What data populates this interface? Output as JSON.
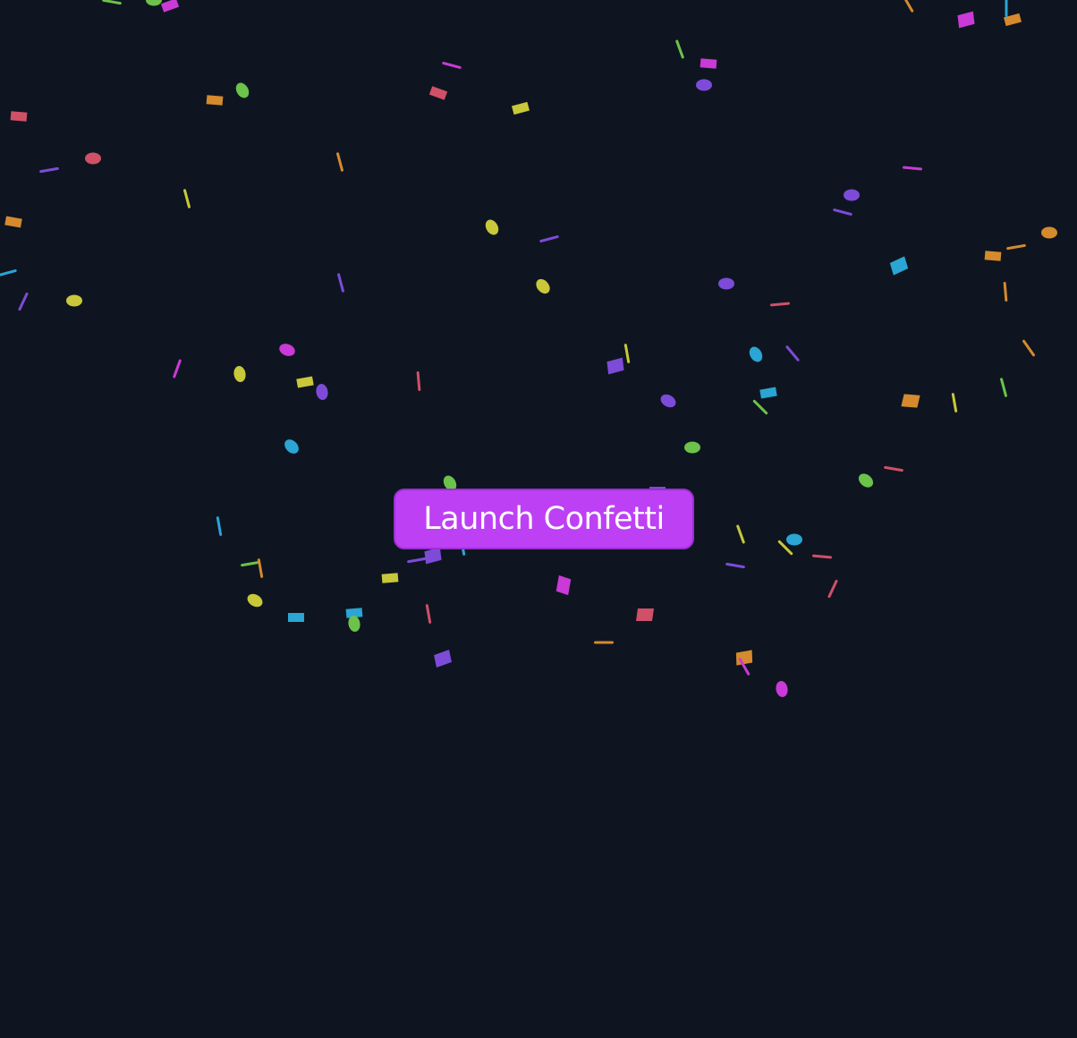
{
  "launch_button": {
    "label": "Launch Confetti"
  },
  "theme": {
    "background": "#0e1520",
    "button_color": "#bd40f5"
  },
  "confetti": {
    "palette": [
      "#c93ad6",
      "#d58a2e",
      "#6cc24a",
      "#d05068",
      "#2aa5d4",
      "#c8c83a",
      "#7d4bd8"
    ]
  }
}
